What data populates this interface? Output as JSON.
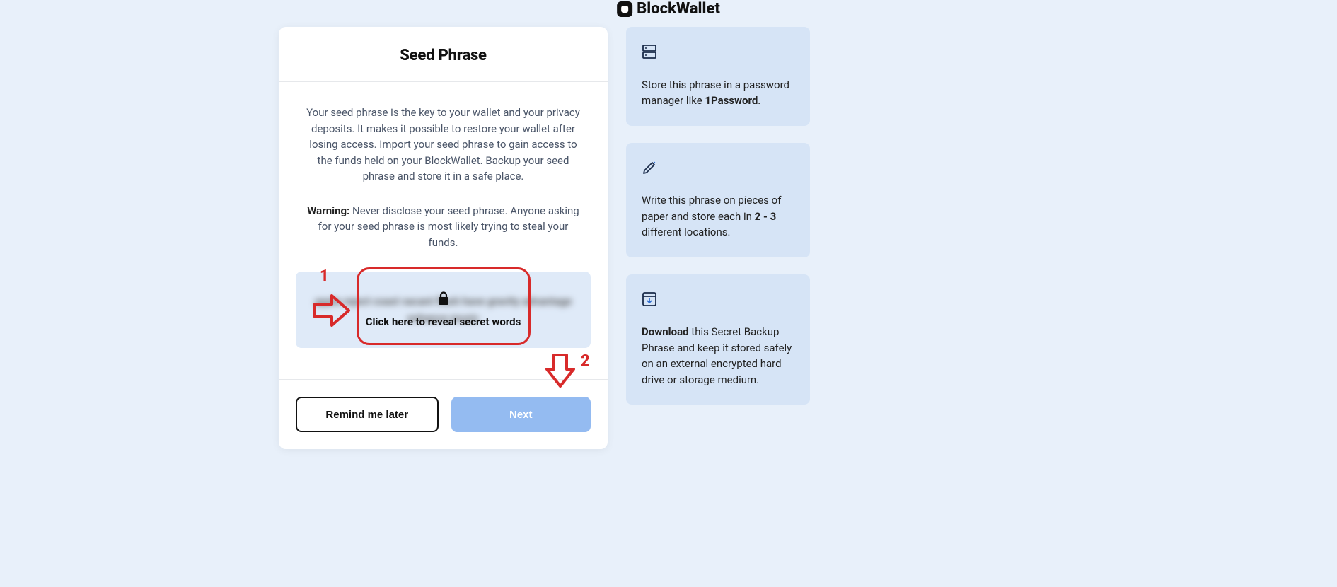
{
  "brand": {
    "name": "BlockWallet"
  },
  "card": {
    "title": "Seed Phrase",
    "description": "Your seed phrase is the key to your wallet and your privacy deposits. It makes it possible to restore your wallet after losing access. Import your seed phrase to gain access to the funds held on your BlockWallet. Backup your seed phrase and store it in a safe place.",
    "warning_label": "Warning:",
    "warning_text": " Never disclose your seed phrase. Anyone asking for your seed phrase is most likely trying to steal your funds.",
    "reveal_text": "Click here to reveal secret words",
    "blurred_placeholder": "apple reject coast vacant flash have gravity advantage enhance music",
    "remind_button": "Remind me later",
    "next_button": "Next"
  },
  "annotations": {
    "label_1": "1",
    "label_2": "2"
  },
  "tips": [
    {
      "icon": "server",
      "text_parts": [
        "Store this phrase in a password manager like ",
        "1Password",
        "."
      ]
    },
    {
      "icon": "pencil",
      "text_parts": [
        "Write this phrase on pieces of paper and store each in ",
        "2 - 3",
        " different locations."
      ]
    },
    {
      "icon": "download",
      "text_parts": [
        "",
        "Download",
        " this Secret Backup Phrase and keep it stored safely on an external encrypted hard drive or storage medium."
      ]
    }
  ]
}
